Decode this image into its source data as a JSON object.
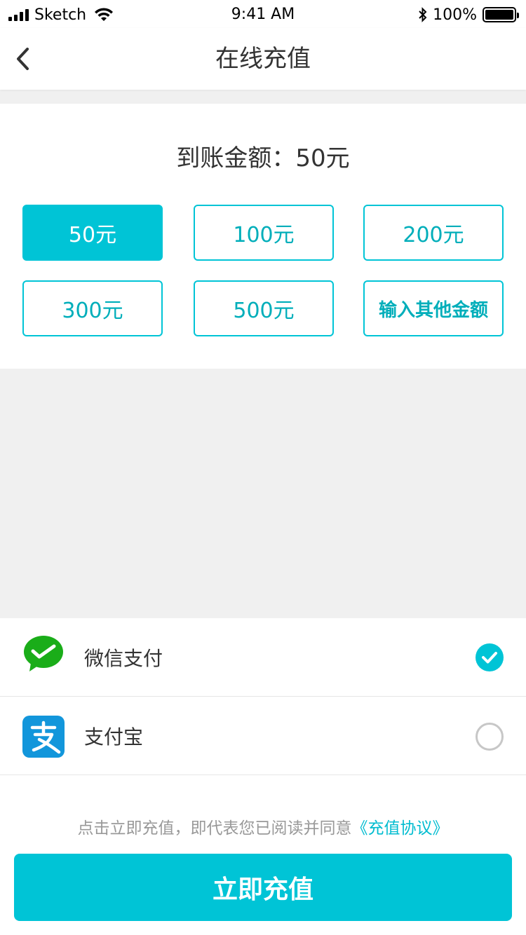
{
  "status_bar": {
    "carrier": "Sketch",
    "time": "9:41 AM",
    "battery": "100%"
  },
  "nav": {
    "title": "在线充值",
    "back_icon": "chevron-left-icon"
  },
  "amount": {
    "summary_label": "到账金额：",
    "summary_value": "50元",
    "options": [
      {
        "label": "50元",
        "selected": true
      },
      {
        "label": "100元",
        "selected": false
      },
      {
        "label": "200元",
        "selected": false
      },
      {
        "label": "300元",
        "selected": false
      },
      {
        "label": "500元",
        "selected": false
      },
      {
        "label": "输入其他金额",
        "selected": false
      }
    ]
  },
  "payment": {
    "methods": [
      {
        "label": "微信支付",
        "icon": "wechat-pay-icon",
        "selected": true
      },
      {
        "label": "支付宝",
        "icon": "alipay-icon",
        "selected": false
      }
    ]
  },
  "footer": {
    "agreement_text": "点击立即充值，即代表您已阅读并同意",
    "agreement_link": "《充值协议》",
    "submit_label": "立即充值"
  },
  "colors": {
    "accent": "#00c4d6",
    "wechat_green": "#1aad19",
    "alipay_blue": "#1296db"
  }
}
